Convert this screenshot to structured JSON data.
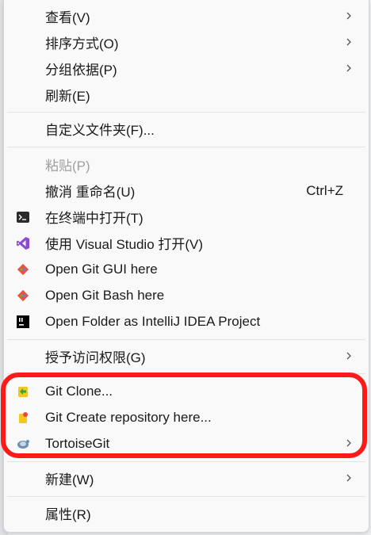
{
  "menu": {
    "view": "查看(V)",
    "sort_by": "排序方式(O)",
    "group_by": "分组依据(P)",
    "refresh": "刷新(E)",
    "customize_folder": "自定义文件夹(F)...",
    "paste": "粘贴(P)",
    "undo_rename": "撤消 重命名(U)",
    "undo_shortcut": "Ctrl+Z",
    "open_in_terminal": "在终端中打开(T)",
    "open_with_vs": "使用 Visual Studio 打开(V)",
    "open_git_gui": "Open Git GUI here",
    "open_git_bash": "Open Git Bash here",
    "open_intellij": "Open Folder as IntelliJ IDEA Project",
    "grant_access": "授予访问权限(G)",
    "git_clone": "Git Clone...",
    "git_create_repo": "Git Create repository here...",
    "tortoisegit": "TortoiseGit",
    "new": "新建(W)",
    "properties": "属性(R)"
  },
  "icons": {
    "terminal": "terminal-icon",
    "visual_studio": "visual-studio-icon",
    "git_gui": "git-gui-icon",
    "git_bash": "git-bash-icon",
    "intellij": "intellij-icon",
    "git_clone": "git-clone-icon",
    "git_create": "git-create-repo-icon",
    "tortoisegit": "tortoisegit-icon"
  },
  "colors": {
    "highlight_border": "#ff1a1a",
    "menu_background": "#f9f9f9",
    "text": "#1a1a1a",
    "disabled_text": "#a0a0a0"
  }
}
